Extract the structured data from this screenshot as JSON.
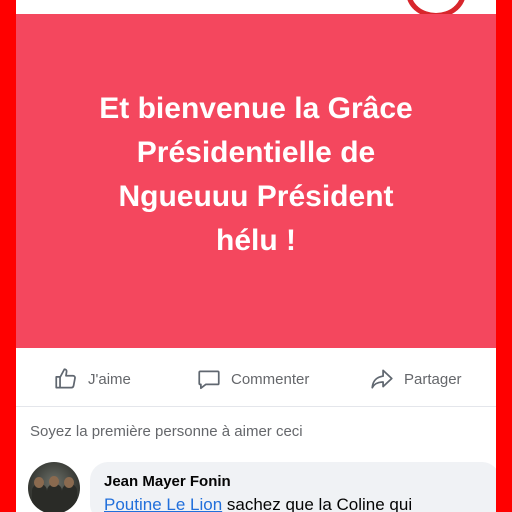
{
  "post": {
    "text": "Et bienvenue la Grâce\nPrésidentielle de\nNgueuuu Président\nhélu !",
    "background_color": "#f4475e"
  },
  "actions": {
    "like_label": "J'aime",
    "comment_label": "Commenter",
    "share_label": "Partager"
  },
  "reactions": {
    "text": "Soyez la première personne à aimer ceci"
  },
  "comment": {
    "author": "Jean Mayer Fonin",
    "mention": "Poutine Le Lion",
    "text": " sachez que la Coline qui"
  },
  "colors": {
    "frame": "#ff0000",
    "mention": "#216fdb"
  },
  "icons": [
    "thumbs-up-icon",
    "comment-bubble-icon",
    "share-arrow-icon"
  ]
}
